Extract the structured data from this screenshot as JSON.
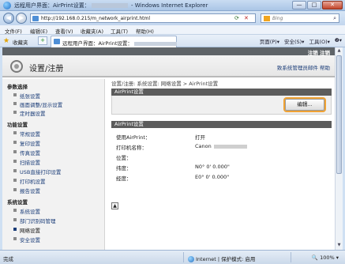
{
  "window": {
    "title_prefix": "远程用户界面：AirPrint设置：",
    "title_suffix": " - Windows Internet Explorer",
    "min": "—",
    "max": "□",
    "close": "✕"
  },
  "address": {
    "url": "http://192.168.0.215/m_network_airprint.html",
    "search_placeholder": "Bing",
    "refresh": "⟳",
    "stop": "✕"
  },
  "menu": [
    "文件(F)",
    "编辑(E)",
    "查看(V)",
    "收藏夹(A)",
    "工具(T)",
    "帮助(H)"
  ],
  "favorites": {
    "label": "收藏夹",
    "tab_label": "远程用户界面：AirPrint设置：",
    "tools": [
      "页面(P)▾",
      "安全(S)▾",
      "工具(O)▾",
      "❷▾"
    ]
  },
  "header": {
    "top_links": "注销 注销",
    "page_title": "设置/注册",
    "links": "致系统管理员邮件  帮助"
  },
  "sidebar": {
    "sections": [
      {
        "label": "参数选择",
        "items": [
          "纸张设置",
          "显示设置",
          "定时器设置"
        ]
      },
      {
        "label": "功能设置",
        "items": [
          "常规设置",
          "复印设置",
          "传真设置",
          "扫描设置",
          "USB直接打印设置",
          "打印机设置",
          "报告设置"
        ]
      },
      {
        "label": "系统设置",
        "items": [
          "系统设置",
          "部门识别码管理",
          "网络设置",
          "安全设置"
        ]
      }
    ],
    "items_override": {
      "0.1": "画面调整/显示设置"
    }
  },
  "main": {
    "breadcrumb": "设置/注册: 系统设置: 网络设置 > AirPrint设置",
    "section1_title": "AirPrint设置",
    "edit_button": "编辑...",
    "section2_title": "AirPrint设置",
    "rows": [
      {
        "label": "使用AirPrint：",
        "value": "打开"
      },
      {
        "label": "打印机名称：",
        "value": "Canon"
      },
      {
        "label": "位置：",
        "value": ""
      },
      {
        "label": "纬度：",
        "value": "N0° 0' 0.000\""
      },
      {
        "label": "经度：",
        "value": "E0° 0' 0.000\""
      }
    ],
    "top_icon": "▲"
  },
  "status": {
    "left": "完成",
    "zone": "Internet | 保护模式: 启用",
    "zoom": "🔍 100% ▾"
  },
  "colors": {
    "edit_highlight": "#f0a233",
    "section_bar": "#5c5c5c",
    "top_strip": "#5f6468"
  }
}
